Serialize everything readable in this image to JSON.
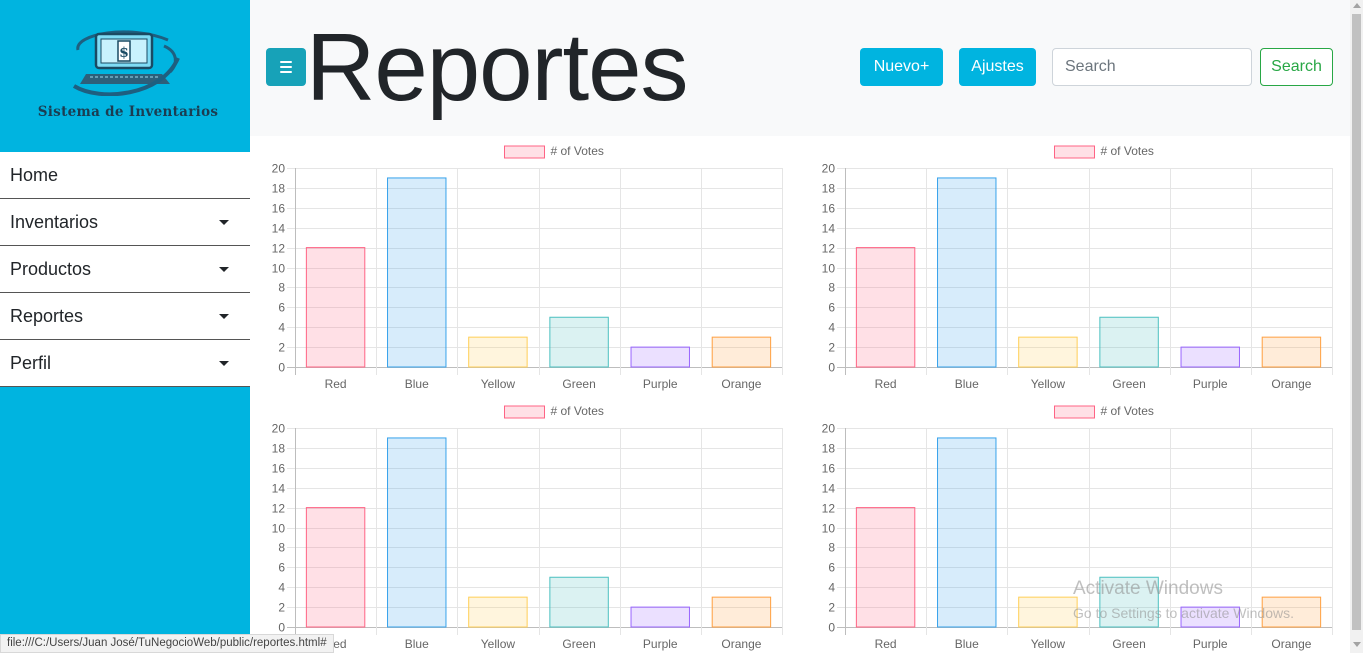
{
  "brand": {
    "name": "Sistema de Inventarios",
    "logo_icon": "computer-dollar-logo"
  },
  "sidebar": {
    "items": [
      {
        "label": "Home",
        "dropdown": false
      },
      {
        "label": "Inventarios",
        "dropdown": true
      },
      {
        "label": "Productos",
        "dropdown": true
      },
      {
        "label": "Reportes",
        "dropdown": true
      },
      {
        "label": "Perfil",
        "dropdown": true
      }
    ]
  },
  "header": {
    "title": "Reportes",
    "toggle_icon": "menu-icon",
    "new_button": "Nuevo+",
    "settings_button": "Ajustes",
    "search_placeholder": "Search",
    "search_value": "",
    "search_button": "Search"
  },
  "colors": {
    "sidebar": "#00b4e0",
    "toggle": "#17a2b8",
    "search_button": "#28a745"
  },
  "chart_data": [
    {
      "type": "bar",
      "categories": [
        "Red",
        "Blue",
        "Yellow",
        "Green",
        "Purple",
        "Orange"
      ],
      "series": [
        {
          "name": "# of Votes",
          "values": [
            12,
            19,
            3,
            5,
            2,
            3
          ]
        }
      ],
      "ylim": [
        0,
        20
      ],
      "yticks": [
        0,
        2,
        4,
        6,
        8,
        10,
        12,
        14,
        16,
        18,
        20
      ],
      "grid": true,
      "legend": "top-center",
      "fill_colors": [
        "rgba(255,99,132,0.2)",
        "rgba(54,162,235,0.2)",
        "rgba(255,206,86,0.2)",
        "rgba(75,192,192,0.2)",
        "rgba(153,102,255,0.2)",
        "rgba(255,159,64,0.2)"
      ],
      "border_colors": [
        "#ff6384",
        "#36a2eb",
        "#ffce56",
        "#4bc0c0",
        "#9966ff",
        "#ff9f40"
      ]
    },
    {
      "type": "bar",
      "categories": [
        "Red",
        "Blue",
        "Yellow",
        "Green",
        "Purple",
        "Orange"
      ],
      "series": [
        {
          "name": "# of Votes",
          "values": [
            12,
            19,
            3,
            5,
            2,
            3
          ]
        }
      ],
      "ylim": [
        0,
        20
      ],
      "yticks": [
        0,
        2,
        4,
        6,
        8,
        10,
        12,
        14,
        16,
        18,
        20
      ],
      "grid": true,
      "legend": "top-center",
      "fill_colors": [
        "rgba(255,99,132,0.2)",
        "rgba(54,162,235,0.2)",
        "rgba(255,206,86,0.2)",
        "rgba(75,192,192,0.2)",
        "rgba(153,102,255,0.2)",
        "rgba(255,159,64,0.2)"
      ],
      "border_colors": [
        "#ff6384",
        "#36a2eb",
        "#ffce56",
        "#4bc0c0",
        "#9966ff",
        "#ff9f40"
      ]
    },
    {
      "type": "bar",
      "categories": [
        "Red",
        "Blue",
        "Yellow",
        "Green",
        "Purple",
        "Orange"
      ],
      "series": [
        {
          "name": "# of Votes",
          "values": [
            12,
            19,
            3,
            5,
            2,
            3
          ]
        }
      ],
      "ylim": [
        0,
        20
      ],
      "yticks": [
        0,
        2,
        4,
        6,
        8,
        10,
        12,
        14,
        16,
        18,
        20
      ],
      "grid": true,
      "legend": "top-center",
      "fill_colors": [
        "rgba(255,99,132,0.2)",
        "rgba(54,162,235,0.2)",
        "rgba(255,206,86,0.2)",
        "rgba(75,192,192,0.2)",
        "rgba(153,102,255,0.2)",
        "rgba(255,159,64,0.2)"
      ],
      "border_colors": [
        "#ff6384",
        "#36a2eb",
        "#ffce56",
        "#4bc0c0",
        "#9966ff",
        "#ff9f40"
      ]
    },
    {
      "type": "bar",
      "categories": [
        "Red",
        "Blue",
        "Yellow",
        "Green",
        "Purple",
        "Orange"
      ],
      "series": [
        {
          "name": "# of Votes",
          "values": [
            12,
            19,
            3,
            5,
            2,
            3
          ]
        }
      ],
      "ylim": [
        0,
        20
      ],
      "yticks": [
        0,
        2,
        4,
        6,
        8,
        10,
        12,
        14,
        16,
        18,
        20
      ],
      "grid": true,
      "legend": "top-center",
      "fill_colors": [
        "rgba(255,99,132,0.2)",
        "rgba(54,162,235,0.2)",
        "rgba(255,206,86,0.2)",
        "rgba(75,192,192,0.2)",
        "rgba(153,102,255,0.2)",
        "rgba(255,159,64,0.2)"
      ],
      "border_colors": [
        "#ff6384",
        "#36a2eb",
        "#ffce56",
        "#4bc0c0",
        "#9966ff",
        "#ff9f40"
      ]
    }
  ],
  "watermark": {
    "title": "Activate Windows",
    "subtitle": "Go to Settings to activate Windows."
  },
  "status_bar": {
    "url": "file:///C:/Users/Juan José/TuNegocioWeb/public/reportes.html#"
  }
}
